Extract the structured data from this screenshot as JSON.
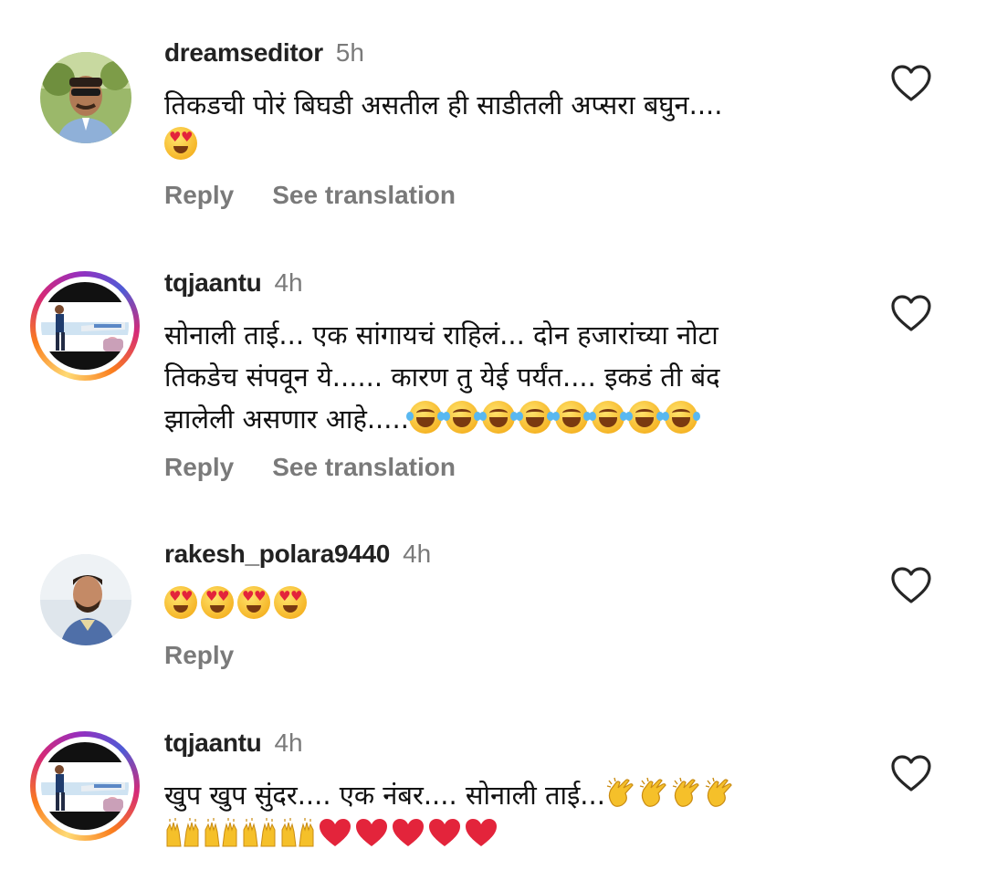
{
  "comments": [
    {
      "username": "dreamseditor",
      "time": "5h",
      "text": "तिकडची पोरं बिघडी असतील ही साडीतली अप्सरा बघुन....",
      "emojis": [
        "heart-eyes"
      ],
      "actions": [
        "Reply",
        "See translation"
      ]
    },
    {
      "username": "tqjaantu",
      "time": "4h",
      "text_line1": "सोनाली ताई... एक सांगायचं राहिलं... दोन हजारांच्या नोटा",
      "text_line2": "तिकडेच संपवून ये...... कारण तु येई पर्यंत.... इकडं ती बंद",
      "text_line3": "झालेली असणार आहे.....",
      "emojis": [
        "laugh",
        "laugh",
        "laugh",
        "laugh",
        "laugh",
        "laugh",
        "laugh",
        "laugh"
      ],
      "actions": [
        "Reply",
        "See translation"
      ]
    },
    {
      "username": "rakesh_polara9440",
      "time": "4h",
      "text": "",
      "emojis": [
        "heart-eyes",
        "heart-eyes",
        "heart-eyes",
        "heart-eyes"
      ],
      "actions": [
        "Reply"
      ]
    },
    {
      "username": "tqjaantu",
      "time": "4h",
      "text": "खुप खुप सुंदर.... एक नंबर.... सोनाली ताई...",
      "emojis_line1": [
        "clapping-hands",
        "clapping-hands",
        "clapping-hands",
        "clapping-hands"
      ],
      "emojis_line2": [
        "raising-hands",
        "raising-hands",
        "raising-hands",
        "raising-hands",
        "red-heart",
        "red-heart",
        "red-heart",
        "red-heart",
        "red-heart"
      ],
      "actions": [
        "Reply"
      ]
    }
  ],
  "colors": {
    "username": "#222222",
    "secondary": "#7a7a7a",
    "red_heart": "#e3243b"
  }
}
